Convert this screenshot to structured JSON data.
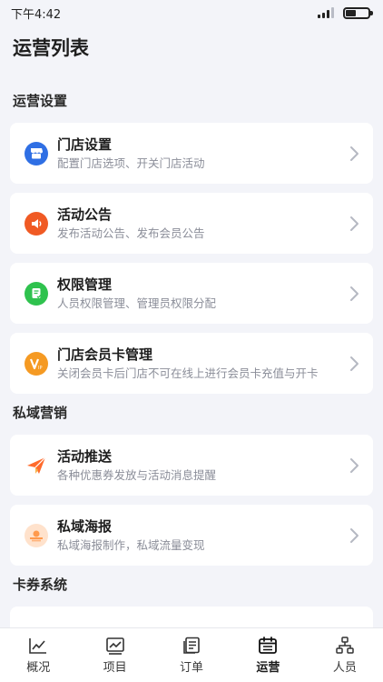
{
  "status": {
    "time": "下午4:42"
  },
  "page": {
    "title": "运营列表"
  },
  "sections": [
    {
      "title": "运营设置"
    },
    {
      "title": "私域营销"
    },
    {
      "title": "卡券系统"
    }
  ],
  "items": [
    {
      "title": "门店设置",
      "desc": "配置门店选项、开关门店活动",
      "icon": "store-icon",
      "color": "#2f6fe4"
    },
    {
      "title": "活动公告",
      "desc": "发布活动公告、发布会员公告",
      "icon": "megaphone-icon",
      "color": "#f05a24"
    },
    {
      "title": "权限管理",
      "desc": "人员权限管理、管理员权限分配",
      "icon": "permission-icon",
      "color": "#2fc24e"
    },
    {
      "title": "门店会员卡管理",
      "desc": "关闭会员卡后门店不可在线上进行会员卡充值与开卡",
      "icon": "vip-icon",
      "color": "#f59a23"
    },
    {
      "title": "活动推送",
      "desc": "各种优惠券发放与活动消息提醒",
      "icon": "paper-plane-icon",
      "color": "#ff6a2b"
    },
    {
      "title": "私域海报",
      "desc": "私域海报制作，私域流量变现",
      "icon": "poster-icon",
      "color": "#ffb37a"
    }
  ],
  "tabs": [
    {
      "label": "概况",
      "icon": "trend-chart-icon",
      "active": false
    },
    {
      "label": "项目",
      "icon": "line-chart-icon",
      "active": false
    },
    {
      "label": "订单",
      "icon": "order-list-icon",
      "active": false
    },
    {
      "label": "运营",
      "icon": "calendar-icon",
      "active": true
    },
    {
      "label": "人员",
      "icon": "org-chart-icon",
      "active": false
    }
  ]
}
